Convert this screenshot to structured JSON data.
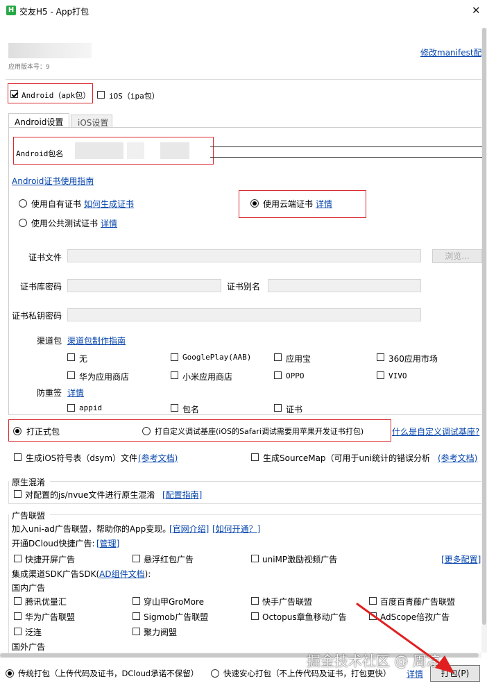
{
  "window": {
    "title": "交友H5 - App打包",
    "app_icon_letter": "H",
    "close_glyph": "✕"
  },
  "header": {
    "version_label": "应用版本号：9",
    "manifest_link": "修改manifest配置"
  },
  "platforms": {
    "android_label": "Android（apk包）",
    "android_checked": true,
    "ios_label": "iOS（ipa包）",
    "ios_checked": false
  },
  "tabs": [
    {
      "label": "Android设置",
      "active": true
    },
    {
      "label": "iOS设置",
      "active": false
    }
  ],
  "android": {
    "package_label": "Android包名",
    "cert_guide_link": "Android证书使用指南",
    "own_cert_label": "使用自有证书",
    "how_to_generate_link": "如何生成证书",
    "public_cert_label": "使用公共测试证书",
    "public_cert_detail": "详情",
    "cloud_cert_label": "使用云端证书",
    "cloud_cert_detail": "详情",
    "cert_file_label": "证书文件",
    "browse_button": "浏览...",
    "keystore_pwd_label": "证书库密码",
    "alias_label": "证书别名",
    "private_key_pwd_label": "证书私钥密码",
    "channel_label": "渠道包",
    "channel_guide_link": "渠道包制作指南",
    "channels": [
      {
        "label": "无",
        "checked": false
      },
      {
        "label": "GooglePlay(AAB)",
        "checked": false
      },
      {
        "label": "应用宝",
        "checked": false
      },
      {
        "label": "360应用市场",
        "checked": false
      },
      {
        "label": "华为应用商店",
        "checked": false
      },
      {
        "label": "小米应用商店",
        "checked": false
      },
      {
        "label": "OPPO",
        "checked": false
      },
      {
        "label": "VIVO",
        "checked": false
      }
    ],
    "anti_resign_label": "防重签",
    "anti_resign_detail": "详情",
    "anti_resign_options": [
      {
        "label": "appid",
        "checked": false
      },
      {
        "label": "包名",
        "checked": false
      },
      {
        "label": "证书",
        "checked": false
      }
    ]
  },
  "build_type": {
    "formal_label": "打正式包",
    "custom_base_label": "打自定义调试基座(iOS的Safari调试需要用苹果开发证书打包)",
    "what_is_link": "什么是自定义调试基座?"
  },
  "symbols": {
    "dsym_label": "生成iOS符号表（dsym）文件",
    "dsym_doc_link": "(参考文档)",
    "sourcemap_label": "生成SourceMap（可用于uni统计的错误分析）",
    "sourcemap_doc_link": "(参考文档)"
  },
  "obfuscation": {
    "group_title": "原生混淆",
    "option_label": "对配置的js/nvue文件进行原生混淆",
    "guide_link": "[配置指南]"
  },
  "ads": {
    "group_title": "广告联盟",
    "intro_text": "加入uni-ad广告联盟，帮助你的App变现。",
    "official_link": "[官网介绍]",
    "how_to_open_link": "[如何开通？]",
    "quick_ads_label": "开通DCloud快捷广告:",
    "manage_link": "[管理]",
    "quick_ads": [
      {
        "label": "快捷开屏广告",
        "checked": false
      },
      {
        "label": "悬浮红包广告",
        "checked": false
      },
      {
        "label": "uniMP激励视频广告",
        "checked": false
      }
    ],
    "more_config_link": "[更多配置]",
    "sdk_label_prefix": "集成渠道SDK广告SDK(",
    "sdk_doc_link": "AD组件文档",
    "sdk_label_suffix": "):",
    "domestic_title": "国内广告",
    "domestic": [
      {
        "label": "腾讯优量汇",
        "checked": false
      },
      {
        "label": "穿山甲GroMore",
        "checked": false
      },
      {
        "label": "快手广告联盟",
        "checked": false
      },
      {
        "label": "百度百青藤广告联盟",
        "checked": false
      },
      {
        "label": "华为广告联盟",
        "checked": false
      },
      {
        "label": "Sigmob广告联盟",
        "checked": false
      },
      {
        "label": "Octopus章鱼移动广告",
        "checked": false
      },
      {
        "label": "AdScope倍孜广告",
        "checked": false
      },
      {
        "label": "泛连",
        "checked": false
      },
      {
        "label": "聚力阅盟",
        "checked": false
      }
    ],
    "overseas_title": "国外广告"
  },
  "footer": {
    "traditional_label": "传统打包（上传代码及证书，DCloud承诺不保留）",
    "safe_label": "快速安心打包（不上传代码及证书，打包更快）",
    "detail_link": "详情",
    "pack_button": "打包(P)"
  },
  "watermark": "掘金技术社区 @ 周凉",
  "colors": {
    "highlight_box": "#d9262c",
    "link": "#0645ad",
    "arrow": "#e02020",
    "app_icon_bg": "#27a845"
  }
}
